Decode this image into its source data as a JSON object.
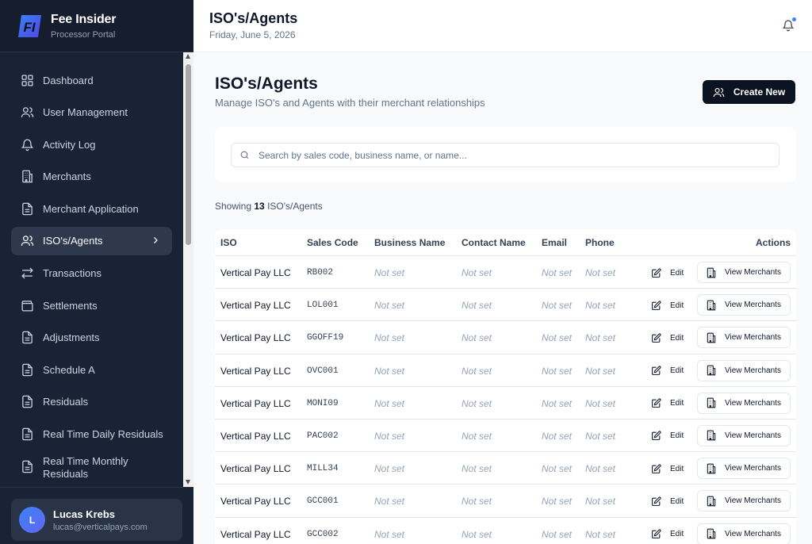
{
  "brand": {
    "name": "Fee Insider",
    "subtitle": "Processor Portal",
    "logo_text": "FI"
  },
  "sidebar": {
    "items": [
      {
        "label": "Dashboard",
        "icon": "grid-icon"
      },
      {
        "label": "User Management",
        "icon": "users-icon"
      },
      {
        "label": "Activity Log",
        "icon": "bell-icon"
      },
      {
        "label": "Merchants",
        "icon": "building-icon"
      },
      {
        "label": "Merchant Application",
        "icon": "file-icon"
      },
      {
        "label": "ISO's/Agents",
        "icon": "users-icon",
        "active": true
      },
      {
        "label": "Transactions",
        "icon": "arrows-icon"
      },
      {
        "label": "Settlements",
        "icon": "wallet-icon"
      },
      {
        "label": "Adjustments",
        "icon": "file-icon"
      },
      {
        "label": "Schedule A",
        "icon": "file-icon"
      },
      {
        "label": "Residuals",
        "icon": "file-icon"
      },
      {
        "label": "Real Time Daily Residuals",
        "icon": "file-icon"
      },
      {
        "label": "Real Time Monthly Residuals",
        "icon": "file-icon"
      }
    ]
  },
  "user": {
    "initial": "L",
    "name": "Lucas Krebs",
    "email": "lucas@verticalpays.com"
  },
  "header": {
    "title": "ISO's/Agents",
    "date": "Friday, June 5, 2026"
  },
  "page": {
    "title": "ISO's/Agents",
    "subtitle": "Manage ISO's and Agents with their merchant relationships",
    "create_label": "Create New",
    "search_placeholder": "Search by sales code, business name, or name...",
    "showing_prefix": "Showing",
    "showing_count": "13",
    "showing_suffix": "ISO's/Agents"
  },
  "table": {
    "columns": [
      "ISO",
      "Sales Code",
      "Business Name",
      "Contact Name",
      "Email",
      "Phone",
      "Actions"
    ],
    "edit_label": "Edit",
    "view_label": "View Merchants",
    "rows": [
      {
        "iso": "Vertical Pay LLC",
        "code": "RB002",
        "business": "Not set",
        "contact": "Not set",
        "email": "Not set",
        "phone": "Not set"
      },
      {
        "iso": "Vertical Pay LLC",
        "code": "LOL001",
        "business": "Not set",
        "contact": "Not set",
        "email": "Not set",
        "phone": "Not set"
      },
      {
        "iso": "Vertical Pay LLC",
        "code": "GGOFF19",
        "business": "Not set",
        "contact": "Not set",
        "email": "Not set",
        "phone": "Not set"
      },
      {
        "iso": "Vertical Pay LLC",
        "code": "OVC001",
        "business": "Not set",
        "contact": "Not set",
        "email": "Not set",
        "phone": "Not set"
      },
      {
        "iso": "Vertical Pay LLC",
        "code": "MONI09",
        "business": "Not set",
        "contact": "Not set",
        "email": "Not set",
        "phone": "Not set"
      },
      {
        "iso": "Vertical Pay LLC",
        "code": "PAC002",
        "business": "Not set",
        "contact": "Not set",
        "email": "Not set",
        "phone": "Not set"
      },
      {
        "iso": "Vertical Pay LLC",
        "code": "MILL34",
        "business": "Not set",
        "contact": "Not set",
        "email": "Not set",
        "phone": "Not set"
      },
      {
        "iso": "Vertical Pay LLC",
        "code": "GCC001",
        "business": "Not set",
        "contact": "Not set",
        "email": "Not set",
        "phone": "Not set"
      },
      {
        "iso": "Vertical Pay LLC",
        "code": "GCC002",
        "business": "Not set",
        "contact": "Not set",
        "email": "Not set",
        "phone": "Not set"
      }
    ]
  },
  "colors": {
    "sidebar_bg": "#1a2235",
    "accent": "#3b82f6",
    "primary_button": "#0b1220"
  }
}
